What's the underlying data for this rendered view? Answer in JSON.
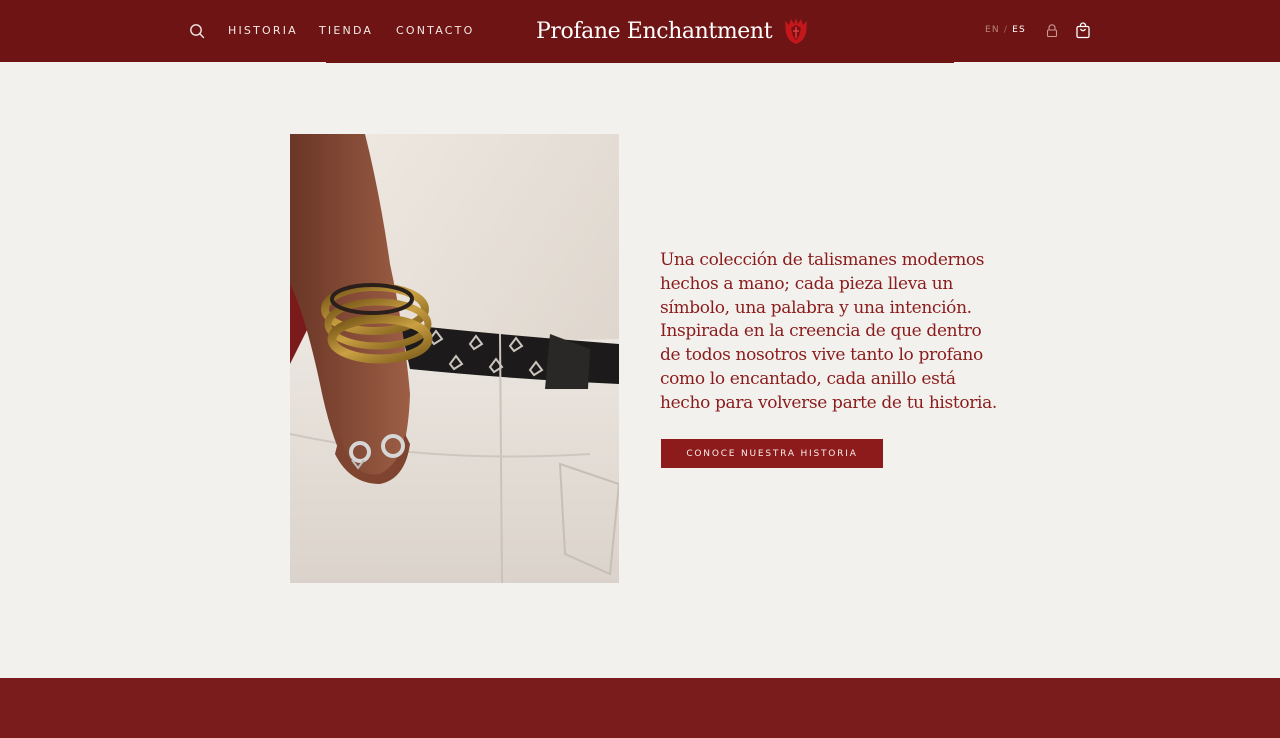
{
  "colors": {
    "header_bg": "#6e1414",
    "accent": "#8d1b1b",
    "text_red": "#8a1c1c",
    "page_bg": "#f2f1ee",
    "footer_bg": "#7a1c1c"
  },
  "header": {
    "search_icon": "search-icon",
    "nav": [
      {
        "label": "HISTORIA"
      },
      {
        "label": "TIENDA"
      },
      {
        "label": "CONTACTO"
      }
    ],
    "brand": {
      "name": "Profane Enchantment",
      "crest_icon": "crest-icon"
    },
    "language": {
      "en": "EN",
      "separator": "/",
      "es": "ES",
      "selected": "ES"
    },
    "account_icon": "lock-icon",
    "cart_icon": "shopping-bag-icon"
  },
  "main": {
    "image_alt": "Mano con brazaletes dorados y anillos de plata en el bolsillo de un pantalón blanco",
    "description": "Una colección de talismanes modernos hechos a mano; cada pieza lleva un símbolo, una palabra y una intención. Inspirada en la creencia de que dentro de todos nosotros vive tanto lo profano como lo encantado, cada anillo está hecho para volverse parte de tu historia.",
    "cta_label": "CONOCE NUESTRA HISTORIA"
  }
}
